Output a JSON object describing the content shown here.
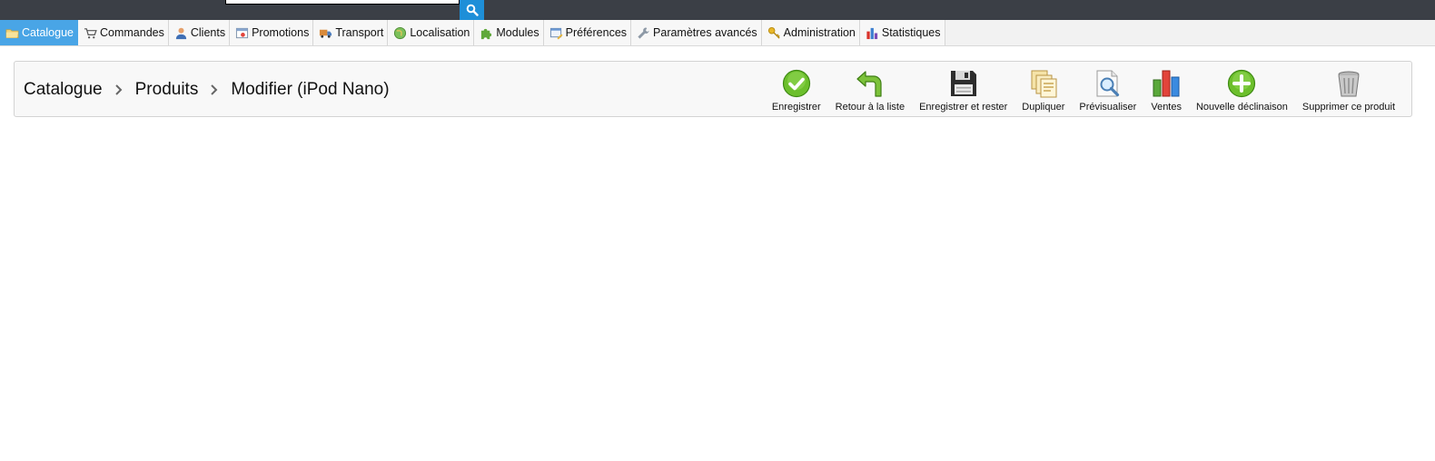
{
  "search": {
    "placeholder": ""
  },
  "nav": {
    "tabs": [
      {
        "label": "Catalogue",
        "icon": "folder-icon"
      },
      {
        "label": "Commandes",
        "icon": "cart-icon"
      },
      {
        "label": "Clients",
        "icon": "user-icon"
      },
      {
        "label": "Promotions",
        "icon": "promotion-icon"
      },
      {
        "label": "Transport",
        "icon": "truck-icon"
      },
      {
        "label": "Localisation",
        "icon": "globe-icon"
      },
      {
        "label": "Modules",
        "icon": "puzzle-icon"
      },
      {
        "label": "Préférences",
        "icon": "preferences-icon"
      },
      {
        "label": "Paramètres avancés",
        "icon": "wrench-icon"
      },
      {
        "label": "Administration",
        "icon": "key-icon"
      },
      {
        "label": "Statistiques",
        "icon": "chart-icon"
      }
    ],
    "active_index": 0
  },
  "breadcrumb": {
    "items": [
      "Catalogue",
      "Produits",
      "Modifier (iPod Nano)"
    ]
  },
  "toolbar": {
    "actions": [
      {
        "label": "Enregistrer",
        "icon": "save-check-icon",
        "color": "#5fb21b"
      },
      {
        "label": "Retour à la liste",
        "icon": "back-arrow-icon",
        "color": "#6bb22a"
      },
      {
        "label": "Enregistrer et rester",
        "icon": "floppy-disk-icon",
        "color": "#333333"
      },
      {
        "label": "Dupliquer",
        "icon": "duplicate-icon",
        "color": "#e8c36a"
      },
      {
        "label": "Prévisualiser",
        "icon": "preview-magnifier-icon",
        "color": "#4a90c8"
      },
      {
        "label": "Ventes",
        "icon": "sales-chart-icon",
        "color": "#d9332b"
      },
      {
        "label": "Nouvelle déclinaison",
        "icon": "add-plus-icon",
        "color": "#5fb21b"
      },
      {
        "label": "Supprimer ce produit",
        "icon": "trash-icon",
        "color": "#8a8a8a"
      }
    ]
  },
  "colors": {
    "topbar": "#3b3f46",
    "accent": "#49a5e6",
    "search_button": "#1e8fd8"
  }
}
